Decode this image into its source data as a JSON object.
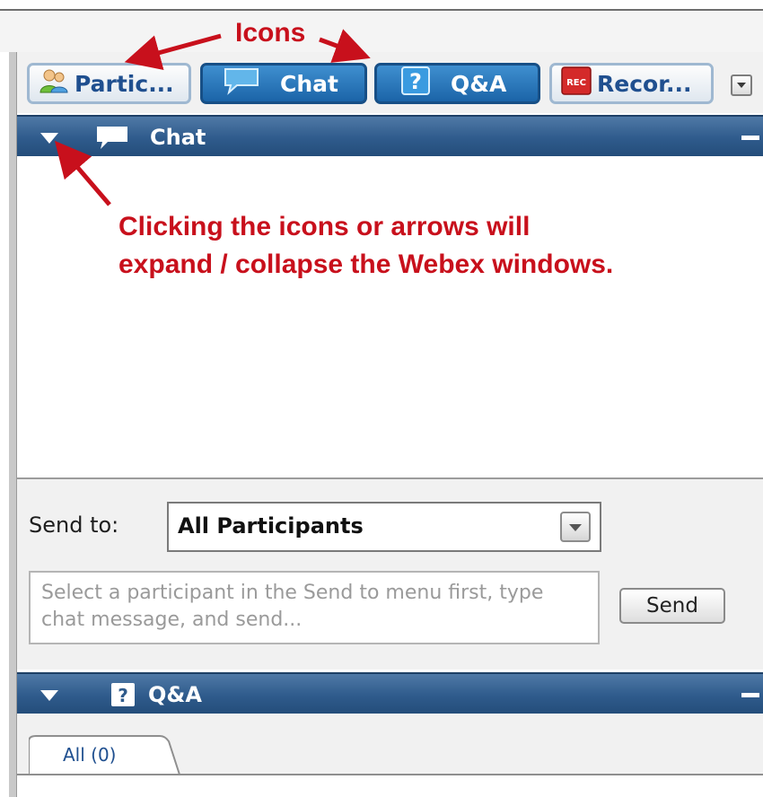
{
  "annotations": {
    "icons_label": "Icons",
    "instruction_line1": "Clicking the icons or arrows will",
    "instruction_line2": "expand / collapse the Webex windows."
  },
  "toolbar": {
    "buttons": [
      {
        "label": "Partic...",
        "icon": "participants-icon",
        "state": "inactive"
      },
      {
        "label": "Chat",
        "icon": "chat-icon",
        "state": "active"
      },
      {
        "label": "Q&A",
        "icon": "question-icon",
        "state": "active"
      },
      {
        "label": "Recor...",
        "icon": "record-icon",
        "icon_text": "REC",
        "state": "inactive"
      }
    ],
    "more_icon": "dropdown-icon"
  },
  "chat_panel": {
    "title": "Chat",
    "send_to_label": "Send to:",
    "send_to_value": "All Participants",
    "message_placeholder": "Select a participant in the Send to menu first, type chat message, and send...",
    "send_button": "Send"
  },
  "qa_panel": {
    "title": "Q&A",
    "icon_text": "?",
    "tabs": [
      {
        "label": "All (0)"
      }
    ]
  },
  "colors": {
    "annotation_red": "#c8101c",
    "header_blue": "#2f5b8c",
    "button_blue": "#1b64a8"
  }
}
